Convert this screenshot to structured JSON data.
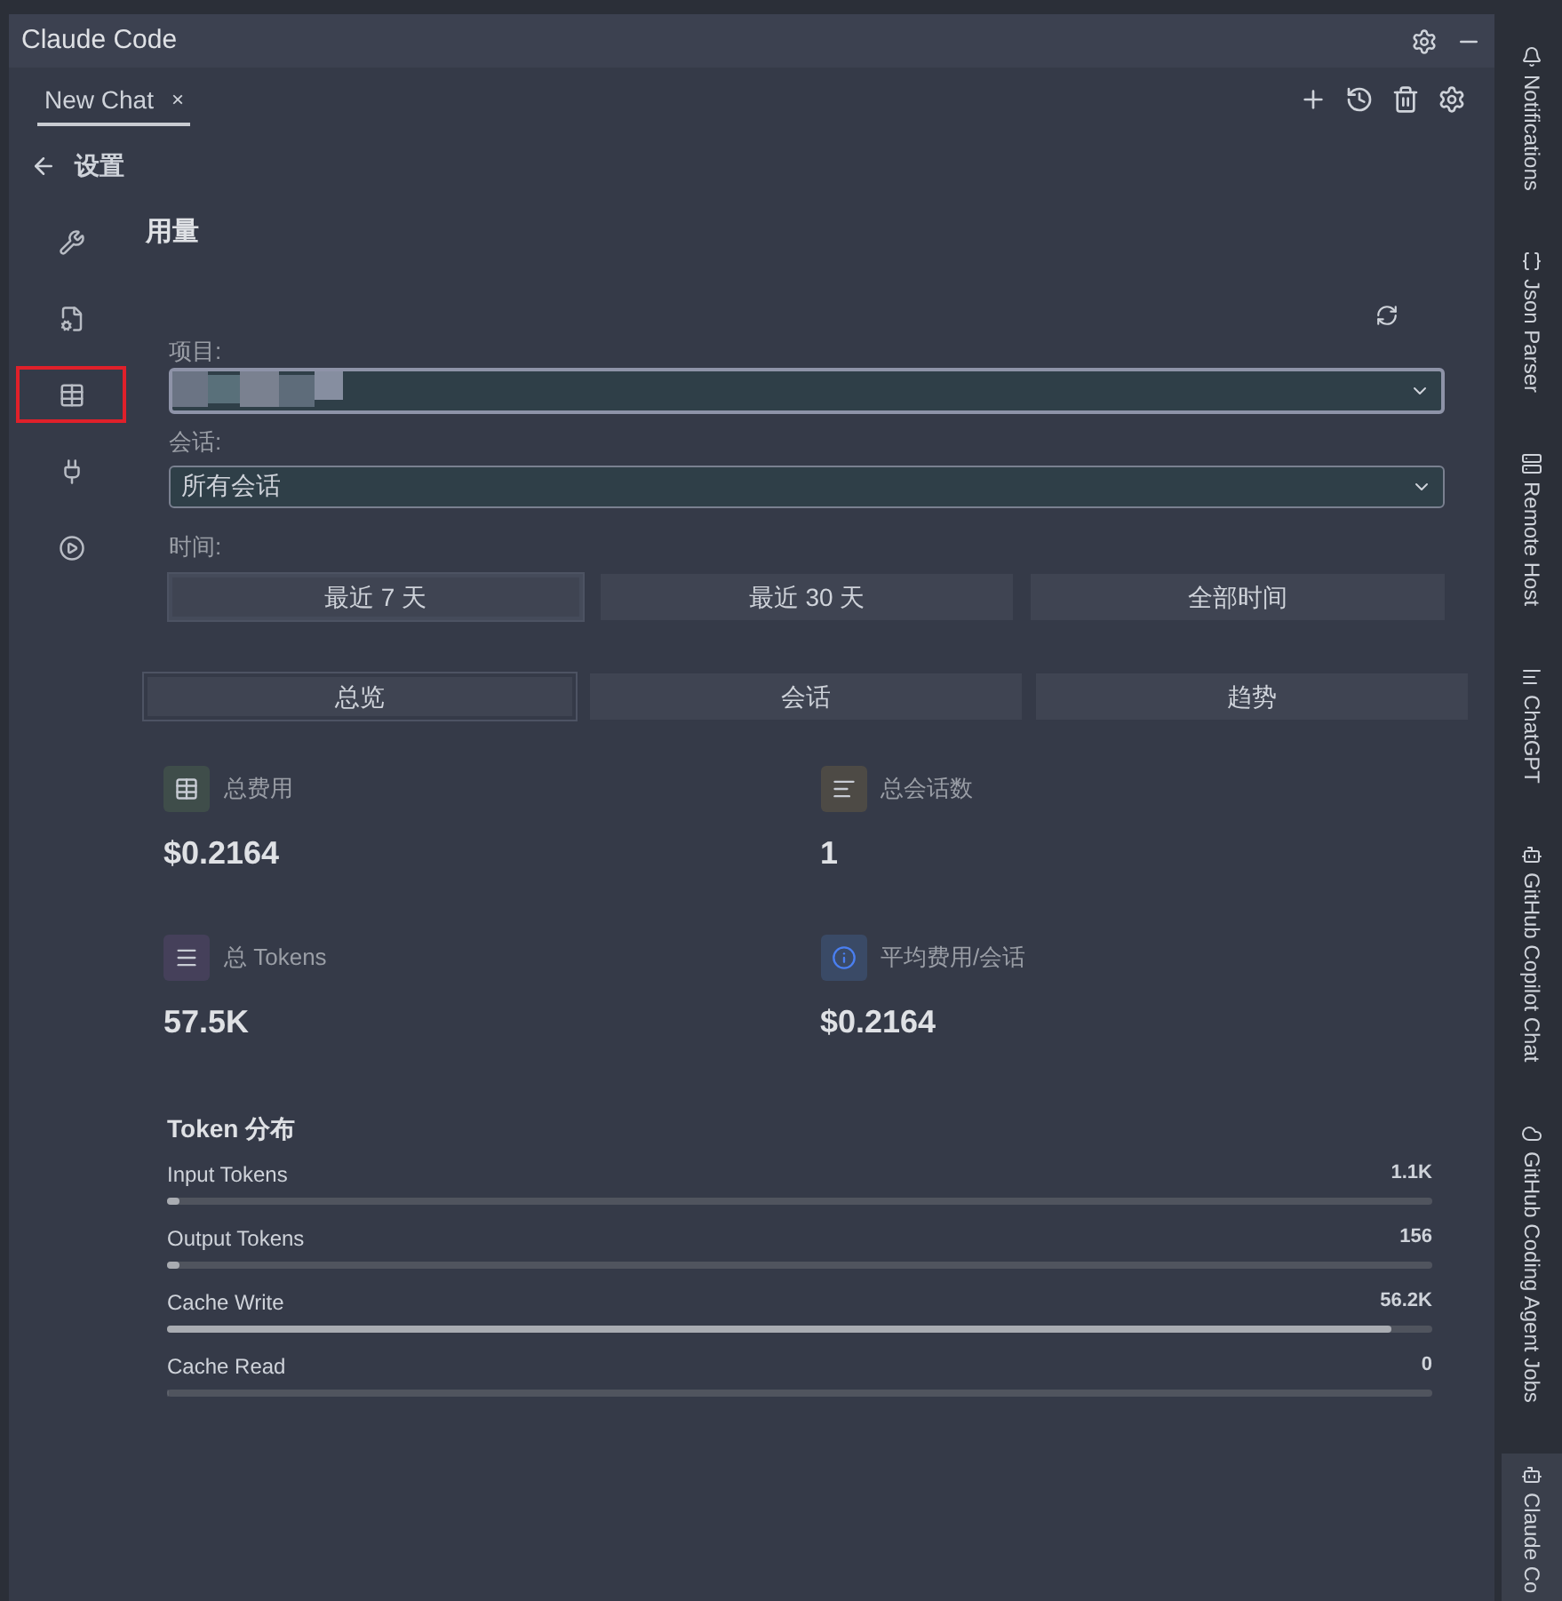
{
  "window": {
    "title": "Claude Code"
  },
  "chat_tabs": [
    {
      "label": "New Chat",
      "close": "×",
      "selected": true
    }
  ],
  "back": {
    "label": "设置"
  },
  "nav": [
    {
      "kind": "wrench",
      "selected": false
    },
    {
      "kind": "doc-gear",
      "selected": false
    },
    {
      "kind": "table",
      "selected": true
    },
    {
      "kind": "plug",
      "selected": false
    },
    {
      "kind": "play",
      "selected": false
    }
  ],
  "page_title": "用量",
  "filters": {
    "project_label": "项目:",
    "session_label": "会话:",
    "session_value": "所有会话",
    "time_label": "时间:"
  },
  "time_ranges": [
    {
      "label": "最近 7 天",
      "selected": true
    },
    {
      "label": "最近 30 天",
      "selected": false
    },
    {
      "label": "全部时间",
      "selected": false
    }
  ],
  "view_tabs": [
    {
      "label": "总览",
      "selected": true
    },
    {
      "label": "会话",
      "selected": false
    },
    {
      "label": "趋势",
      "selected": false
    }
  ],
  "stats": [
    {
      "kind": "table",
      "label": "总费用",
      "value": "$0.2164",
      "color": "#3f4d4a"
    },
    {
      "kind": "lines",
      "label": "总会话数",
      "value": "1",
      "color": "#4d4a45"
    },
    {
      "kind": "menu",
      "label": "总 Tokens",
      "value": "57.5K",
      "color": "#45405a"
    },
    {
      "kind": "info",
      "label": "平均费用/会话",
      "value": "$0.2164",
      "color": "#3a4a66"
    }
  ],
  "token_distribution": {
    "title": "Token 分布",
    "rows": [
      {
        "label": "Input Tokens",
        "value": "1.1K",
        "level": 0.01
      },
      {
        "label": "Output Tokens",
        "value": "156",
        "level": 0.003
      },
      {
        "label": "Cache Write",
        "value": "56.2K",
        "level": 0.968
      },
      {
        "label": "Cache Read",
        "value": "0",
        "level": 0
      }
    ]
  },
  "right_sidebar": [
    {
      "label": "Notifications",
      "selected": false
    },
    {
      "label": "Json Parser",
      "selected": false
    },
    {
      "label": "Remote Host",
      "selected": false
    },
    {
      "label": "ChatGPT",
      "selected": false
    },
    {
      "label": "GitHub Copilot Chat",
      "selected": false
    },
    {
      "label": "GitHub Coding Agent Jobs",
      "selected": false
    },
    {
      "label": "Claude Co",
      "selected": true
    }
  ]
}
